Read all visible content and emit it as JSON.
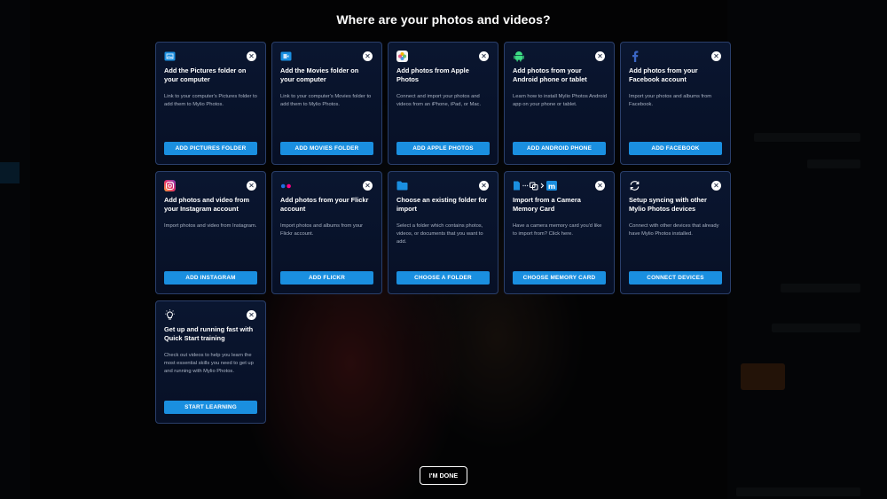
{
  "title": "Where are your photos and videos?",
  "done_label": "I'M DONE",
  "accent_color": "#1a8fe0",
  "cards": [
    {
      "icon": "pictures-folder-icon",
      "title": "Add the Pictures folder on your computer",
      "description": "Link to your computer's Pictures folder to add them to Mylio Photos.",
      "button": "ADD PICTURES FOLDER"
    },
    {
      "icon": "movies-folder-icon",
      "title": "Add the Movies folder on your computer",
      "description": "Link to your computer's Movies folder to add them to Mylio Photos.",
      "button": "ADD MOVIES FOLDER"
    },
    {
      "icon": "apple-photos-icon",
      "title": "Add photos from Apple Photos",
      "description": "Connect and import your photos and videos from an iPhone, iPad, or Mac.",
      "button": "ADD APPLE PHOTOS"
    },
    {
      "icon": "android-icon",
      "title": "Add photos from your Android phone or tablet",
      "description": "Learn how to install Mylio Photos Android app on your phone or tablet.",
      "button": "ADD ANDROID PHONE"
    },
    {
      "icon": "facebook-icon",
      "title": "Add photos from your Facebook account",
      "description": "Import your photos and albums from Facebook.",
      "button": "ADD FACEBOOK"
    },
    {
      "icon": "instagram-icon",
      "title": "Add photos and video from your Instagram account",
      "description": "Import photos and video from Instagram.",
      "button": "ADD INSTAGRAM"
    },
    {
      "icon": "flickr-icon",
      "title": "Add photos from your Flickr account",
      "description": "Import photos and albums from your Flickr account.",
      "button": "ADD FLICKR"
    },
    {
      "icon": "folder-icon",
      "title": "Choose an existing folder for import",
      "description": "Select a folder which contains photos, videos, or documents that you want to add.",
      "button": "CHOOSE A FOLDER"
    },
    {
      "icon": "memory-card-icon",
      "title": "Import from a Camera Memory Card",
      "description": "Have a camera memory card you'd like to import from? Click here.",
      "button": "CHOOSE MEMORY CARD"
    },
    {
      "icon": "sync-icon",
      "title": "Setup syncing with other Mylio Photos devices",
      "description": "Connect with other devices that already have Mylio Photos installed.",
      "button": "CONNECT DEVICES"
    },
    {
      "icon": "lightbulb-icon",
      "title": "Get up and running fast with Quick Start training",
      "description": "Check out videos to help you learn the most essential skills you need to get up and running with Mylio Photos.",
      "button": "START LEARNING"
    }
  ]
}
